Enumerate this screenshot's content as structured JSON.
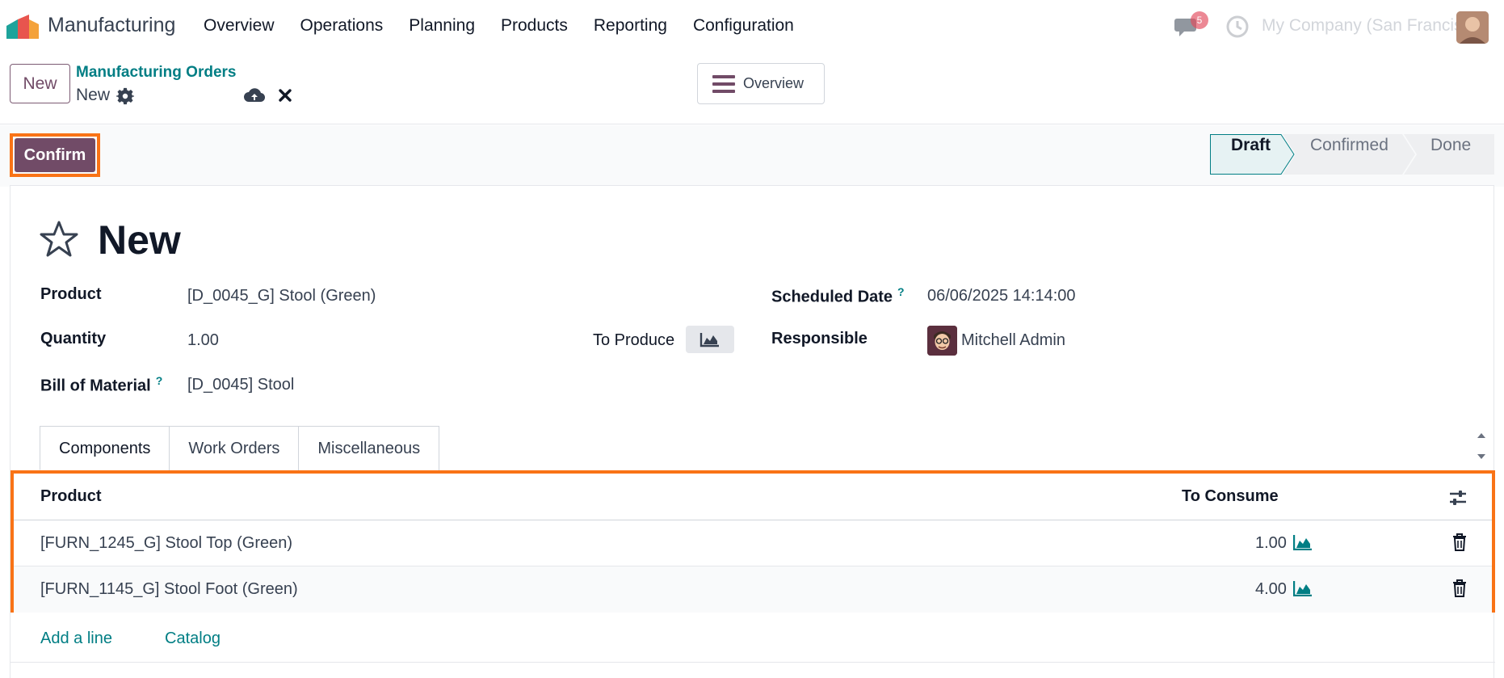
{
  "navbar": {
    "app_name": "Manufacturing",
    "menu": [
      "Overview",
      "Operations",
      "Planning",
      "Products",
      "Reporting",
      "Configuration"
    ],
    "company": "My Company (San Francisco)",
    "chat_badge": "5"
  },
  "control": {
    "new_label": "New",
    "breadcrumb_parent": "Manufacturing Orders",
    "breadcrumb_current": "New",
    "overview_label": "Overview"
  },
  "statusbar": {
    "confirm_label": "Confirm",
    "stages": [
      "Draft",
      "Confirmed",
      "Done"
    ],
    "active_stage": "Draft"
  },
  "form": {
    "title": "New",
    "product_label": "Product",
    "product_value": "[D_0045_G] Stool (Green)",
    "quantity_label": "Quantity",
    "quantity_value": "1.00",
    "to_produce_label": "To Produce",
    "bom_label": "Bill of Material",
    "bom_value": "[D_0045] Stool",
    "scheduled_label": "Scheduled Date",
    "scheduled_value": "06/06/2025 14:14:00",
    "responsible_label": "Responsible",
    "responsible_value": "Mitchell Admin",
    "help_mark": "?"
  },
  "tabs": [
    "Components",
    "Work Orders",
    "Miscellaneous"
  ],
  "components": {
    "headers": {
      "product": "Product",
      "to_consume": "To Consume"
    },
    "rows": [
      {
        "product": "[FURN_1245_G] Stool Top (Green)",
        "to_consume": "1.00"
      },
      {
        "product": "[FURN_1145_G] Stool Foot (Green)",
        "to_consume": "4.00"
      }
    ],
    "add_line": "Add a line",
    "catalog": "Catalog"
  },
  "colors": {
    "brand": "#714b67",
    "link": "#017e84",
    "highlight": "#f97316"
  }
}
